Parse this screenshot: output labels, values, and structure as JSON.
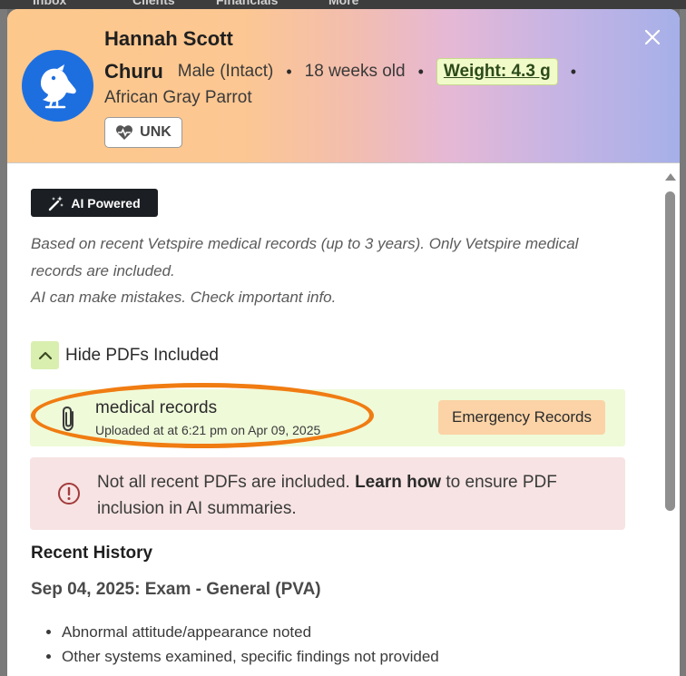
{
  "background": {
    "nav_items": [
      "Inbox",
      "Clients",
      "Financials",
      "More"
    ]
  },
  "header": {
    "owner_name": "Hannah Scott",
    "pet_name": "Churu",
    "sex": "Male (Intact)",
    "age": "18 weeks old",
    "weight_label": "Weight: 4.3 g",
    "species": "African Gray Parrot",
    "status_badge": "UNK",
    "avatar_icon": "bird-icon",
    "close_icon": "close-icon"
  },
  "ai": {
    "badge_label": "AI Powered",
    "disclaimer_line1": "Based on recent Vetspire medical records (up to 3 years). Only Vetspire medical records are included.",
    "disclaimer_line2": "AI can make mistakes. Check important info."
  },
  "pdfs": {
    "toggle_label": "Hide PDFs Included",
    "items": [
      {
        "title": "medical records",
        "uploaded": "Uploaded at at 6:21 pm on Apr 09, 2025",
        "tag": "Emergency Records"
      }
    ]
  },
  "warning": {
    "text_before": "Not all recent PDFs are included.",
    "link": "Learn how",
    "text_after": "to ensure PDF inclusion in AI summaries."
  },
  "history": {
    "title": "Recent History",
    "visit_title": "Sep 04, 2025: Exam - General (PVA)",
    "bullets": [
      "Abnormal attitude/appearance noted",
      "Other systems examined, specific findings not provided"
    ]
  },
  "colors": {
    "accent_green": "#d9efb0",
    "highlight_orange": "#f07c12",
    "avatar_blue": "#1d6fe0"
  }
}
